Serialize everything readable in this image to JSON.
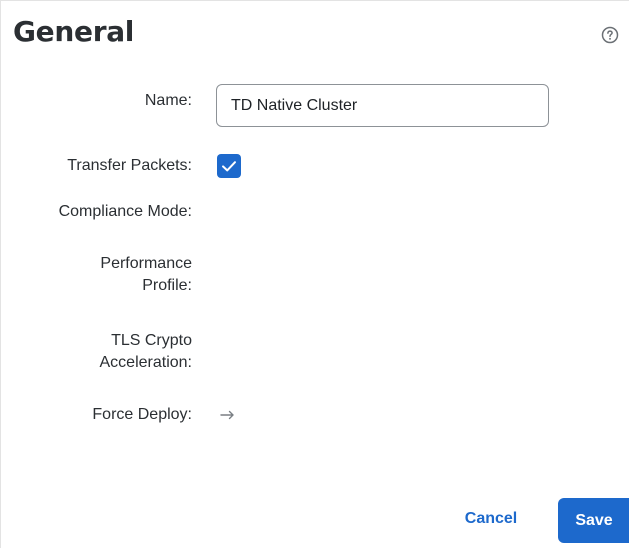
{
  "dialog": {
    "title": "General",
    "help_icon": "question-circle-icon"
  },
  "form": {
    "name_label": "Name:",
    "name_value": "TD Native Cluster",
    "transfer_packets_label": "Transfer Packets:",
    "transfer_packets_checked": true,
    "compliance_mode_label": "Compliance Mode:",
    "performance_profile_label_line1": "Performance",
    "performance_profile_label_line2": "Profile:",
    "tls_label_line1": "TLS Crypto",
    "tls_label_line2": "Acceleration:",
    "force_deploy_label": "Force Deploy:",
    "force_deploy_icon": "arrow-right-icon"
  },
  "footer": {
    "cancel_label": "Cancel",
    "save_label": "Save"
  },
  "colors": {
    "accent": "#1d69cc",
    "text": "#2b2f33",
    "border": "#8d9297"
  }
}
